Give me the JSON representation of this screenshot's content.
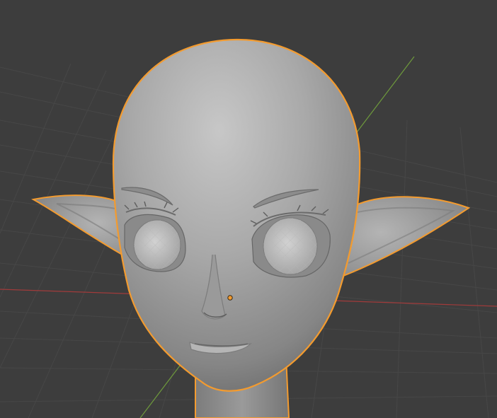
{
  "viewport": {
    "background": "#3d3d3d",
    "grid_color": "#474747",
    "x_axis_color": "#a13b3b",
    "y_axis_color": "#6e9a3c",
    "selection_outline_color": "#f39b2f",
    "origin_color": "#f39b2f",
    "mesh_base_color": "#9b9b9b"
  },
  "selected_object": {
    "kind": "sculpted elf head mesh",
    "selected": true
  }
}
